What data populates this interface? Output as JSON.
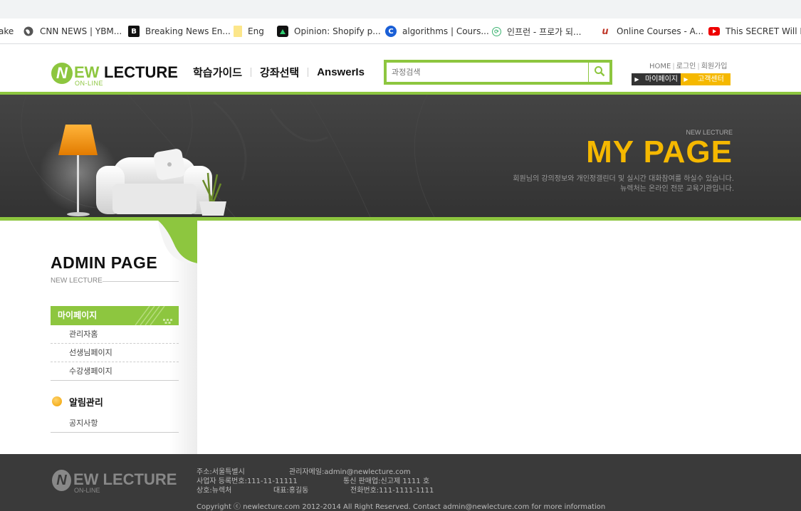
{
  "bookmarks": [
    {
      "label": "ake",
      "icon": "none-icon"
    },
    {
      "label": "CNN NEWS | YBM...",
      "icon": "globe-icon"
    },
    {
      "label": "Breaking News En...",
      "icon": "b-logo-icon"
    },
    {
      "label": "Eng",
      "icon": "note-icon"
    },
    {
      "label": "Opinion: Shopify p...",
      "icon": "triangle-logo-icon"
    },
    {
      "label": "algorithms | Cours...",
      "icon": "c-logo-icon"
    },
    {
      "label": "인프런 - 프로가 되...",
      "icon": "inflearn-icon"
    },
    {
      "label": "Online Courses - A...",
      "icon": "udemy-icon"
    },
    {
      "label": "This SECRET Will D...",
      "icon": "youtube-icon"
    }
  ],
  "header": {
    "logo": {
      "initial": "N",
      "ew": "EW",
      "lecture": "LECTURE",
      "sub": "ON-LINE"
    },
    "nav": [
      "학습가이드",
      "강좌선택",
      "AnswerIs"
    ],
    "search": {
      "placeholder": "과정검색"
    },
    "util_links": [
      "HOME",
      "로그인",
      "회원가입"
    ],
    "mypage_label": "마이페이지",
    "support_label": "고객센터"
  },
  "banner": {
    "small": "NEW LECTURE",
    "title": "MY PAGE",
    "desc_line1": "회원님의 강의정보와 개인정갤린더 및 실시간 대화참여를 하실수 있습니다.",
    "desc_line2": "뉴렉처는 온라인 전문 교육기관입니다."
  },
  "sidebar": {
    "title": "ADMIN PAGE",
    "sub": "NEW LECTURE",
    "category": "마이페이지",
    "items": [
      "관리자홈",
      "선생님페이지",
      "수강생페이지"
    ],
    "notice_head": "알림관리",
    "notice_items": [
      "공지사항"
    ]
  },
  "footer": {
    "logo": {
      "initial": "N",
      "text": "EW LECTURE",
      "sub": "ON-LINE"
    },
    "address": "주소:서울특별시",
    "admin_mail": "관리자메일:admin@newlecture.com",
    "biz_no": "사업자 등록번호:111-11-11111",
    "mail_order": "통신 판매업:신고제 1111 호",
    "company": "상호:뉴렉처",
    "ceo": "대표:홍길동",
    "phone": "전화번호:111-1111-1111",
    "copyright": "Copyright ⓒ newlecture.com 2012-2014 All Right Reserved. Contact admin@newlecture.com for more information"
  },
  "colors": {
    "brand_green": "#8dc63f",
    "accent_yellow": "#f5b800",
    "dark_bg": "#3a3a3a"
  }
}
